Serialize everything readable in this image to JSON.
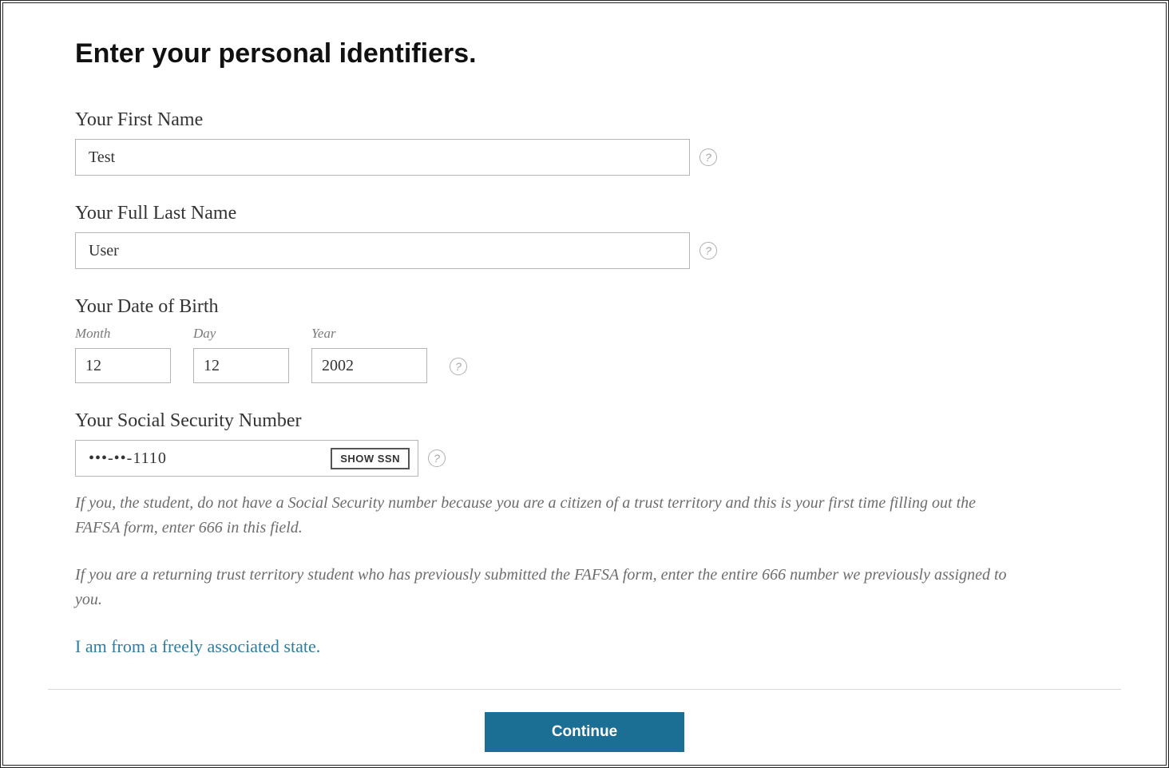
{
  "title": "Enter your personal identifiers.",
  "first_name": {
    "label": "Your First Name",
    "value": "Test"
  },
  "last_name": {
    "label": "Your Full Last Name",
    "value": "User"
  },
  "dob": {
    "label": "Your Date of Birth",
    "month_label": "Month",
    "day_label": "Day",
    "year_label": "Year",
    "month": "12",
    "day": "12",
    "year": "2002"
  },
  "ssn": {
    "label": "Your Social Security Number",
    "masked_value": "•••-••-1110",
    "show_button": "SHOW SSN"
  },
  "help_text_1": "If you, the student, do not have a Social Security number because you are a citizen of a trust territory and this is your first time filling out the FAFSA form, enter 666 in this field.",
  "help_text_2": "If you are a returning trust territory student who has previously submitted the FAFSA form, enter the entire 666 number we previously assigned to you.",
  "fas_link": "I am from a freely associated state.",
  "continue_label": "Continue",
  "help_glyph": "?"
}
